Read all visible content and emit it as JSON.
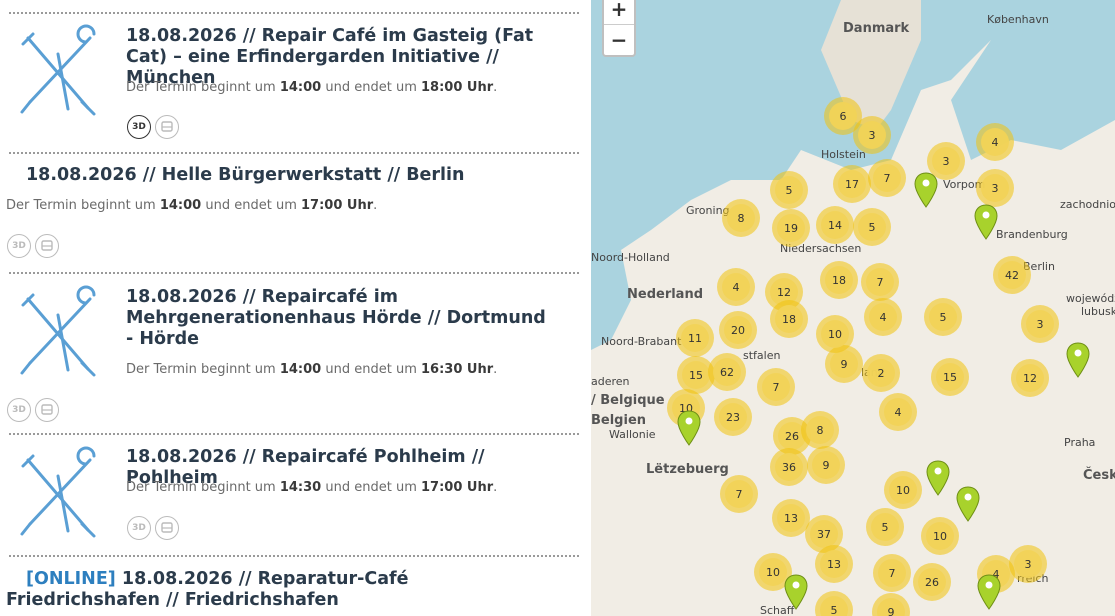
{
  "events": [
    {
      "date": "18.08.2026",
      "title": "18.08.2026 // Repair Café im Gasteig (Fat Cat) – eine Erfindergarden Initiative // München",
      "time_prefix": "Der Termin beginnt um",
      "start": "14:00",
      "mid": "und endet um",
      "end": "18:00 Uhr",
      "suffix": ".",
      "has_3d_printer": true
    },
    {
      "title": "18.08.2026 // Helle Bürgerwerkstatt // Berlin",
      "time_prefix": "Der Termin beginnt um",
      "start": "14:00",
      "mid": "und endet um",
      "end": "17:00 Uhr",
      "suffix": "."
    },
    {
      "title": "18.08.2026 // Repaircafé im Mehrgenerationenhaus Hörde // Dortmund - Hörde",
      "time_prefix": "Der Termin beginnt um",
      "start": "14:00",
      "mid": "und endet um",
      "end": "16:30 Uhr",
      "suffix": "."
    },
    {
      "title": "18.08.2026 // Repaircafé Pohlheim // Pohlheim",
      "time_prefix": "Der Termin beginnt um",
      "start": "14:30",
      "mid": "und endet um",
      "end": "17:00 Uhr",
      "suffix": "."
    },
    {
      "online": "[ONLINE]",
      "title": "18.08.2026 // Reparatur-Café Friedrichshafen // Friedrichshafen"
    }
  ],
  "icons": {
    "printer3d": "3D",
    "bus": "bus-icon"
  },
  "map": {
    "zoom_in": "+",
    "zoom_out": "−",
    "labels": {
      "danmark": "Danmark",
      "kobenhavn": "København",
      "nederland": "Nederland",
      "belgique": "/ Belgique",
      "belgien": "Belgien",
      "wallonie": "Wallonie",
      "letzebuerg": "Lëtzebuerg",
      "praha": "Praha",
      "cesko": "Česko",
      "berlin": "Berlin",
      "holstein": "Holstein",
      "niedersachsen": "Niedersachsen",
      "groning": "Groning",
      "noord_holland": "Noord-Holland",
      "noord_brabant": "Noord-Brabant",
      "vorpomm": "Vorpom",
      "brandenburg": "Brandenburg",
      "wojewodz": "wojewódz",
      "lubusk": "lubusk",
      "zachodniop": "zachodniop",
      "estfalen": "stfalen",
      "aderen": "aderen",
      "schaff": "Schaff",
      "land": "land",
      "ge": "Ge",
      "reich": "rreich"
    },
    "clusters": [
      "6",
      "3",
      "3",
      "4",
      "5",
      "17",
      "7",
      "3",
      "14",
      "5",
      "19",
      "8",
      "18",
      "7",
      "42",
      "12",
      "4",
      "18",
      "20",
      "4",
      "5",
      "11",
      "10",
      "3",
      "15",
      "62",
      "9",
      "2",
      "7",
      "15",
      "12",
      "10",
      "23",
      "26",
      "8",
      "4",
      "36",
      "9",
      "7",
      "10",
      "13",
      "37",
      "5",
      "10",
      "7",
      "26",
      "10",
      "13",
      "4",
      "3",
      "5",
      "9"
    ],
    "colors": {
      "water": "#aad3df",
      "land": "#f1ede5",
      "cluster_outer": "#f0c20c",
      "cluster_inner": "#f1d357",
      "pin": "#a8d22c"
    }
  }
}
